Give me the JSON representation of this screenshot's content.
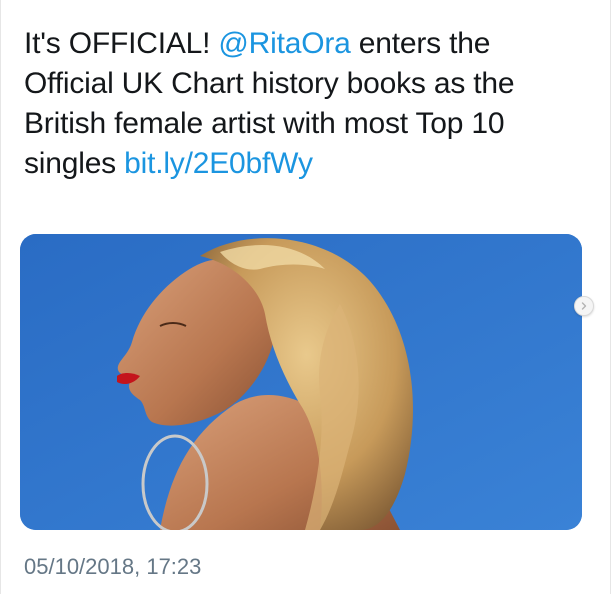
{
  "tweet": {
    "text_part1": "It's OFFICIAL! ",
    "mention": "@RitaOra",
    "text_part2": " enters the Official UK Chart history books as the British female artist with most Top 10 singles ",
    "link": "bit.ly/2E0bfWy",
    "timestamp": "05/10/2018, 17:23"
  },
  "media": {
    "icon": "photo-media",
    "background_color": "#2f74c9"
  },
  "carousel": {
    "next_icon": "chevron-right-icon"
  },
  "colors": {
    "text": "#14171a",
    "link": "#1b95e0",
    "muted": "#657786"
  }
}
